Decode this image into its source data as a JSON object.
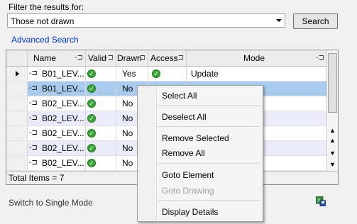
{
  "filter": {
    "label": "Filter the results for:",
    "selected": "Those not drawn",
    "search_label": "Search",
    "advanced_link": "Advanced Search"
  },
  "grid": {
    "columns": {
      "name": "Name",
      "valid": "Valid",
      "drawn": "Drawn",
      "access": "Access",
      "mode": "Mode"
    },
    "rows": [
      {
        "name": "B01_LEV...",
        "drawn": "Yes",
        "mode": "Update"
      },
      {
        "name": "B01_LEV...",
        "drawn": "No",
        "mode": ""
      },
      {
        "name": "B02_LEV...",
        "drawn": "No",
        "mode": ""
      },
      {
        "name": "B02_LEV...",
        "drawn": "No",
        "mode": ""
      },
      {
        "name": "B02_LEV...",
        "drawn": "No",
        "mode": ""
      },
      {
        "name": "B02_LEV...",
        "drawn": "No",
        "mode": ""
      },
      {
        "name": "B02_LEV...",
        "drawn": "No",
        "mode": ""
      }
    ],
    "total_items": "Total Items = 7"
  },
  "switch_mode": "Switch to Single Mode",
  "context_menu": {
    "select_all": "Select All",
    "deselect_all": "Deselect All",
    "remove_selected": "Remove Selected",
    "remove_all": "Remove All",
    "goto_element": "Goto Element",
    "goto_drawing": "Goto Drawing",
    "display_details": "Display Details"
  },
  "colors": {
    "link": "#0033cc",
    "selected_row": "#a8cbee",
    "alt_row": "#ebebfa",
    "check_green": "#3aa63a"
  }
}
